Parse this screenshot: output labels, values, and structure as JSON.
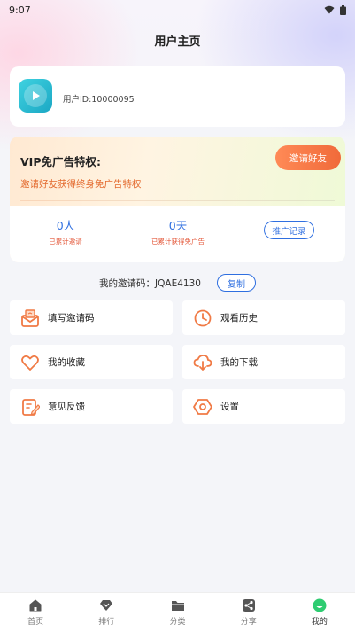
{
  "status_bar": {
    "time": "9:07",
    "icons": [
      "wifi-icon",
      "battery-icon"
    ]
  },
  "header": {
    "title": "用户主页"
  },
  "user": {
    "id_text": "用户ID:10000095",
    "avatar_icon": "play-icon"
  },
  "vip": {
    "title": "VIP免广告特权:",
    "subtitle": "邀请好友获得终身免广告特权",
    "invite_button": "邀请好友",
    "stats": [
      {
        "value": "0人",
        "label": "已累计邀请"
      },
      {
        "value": "0天",
        "label": "已累计获得免广告"
      }
    ],
    "record_button": "推广记录"
  },
  "invite_code": {
    "text": "我的邀请码：JQAE4130",
    "copy_button": "复制"
  },
  "menu": [
    {
      "label": "填写邀请码",
      "icon": "mail-icon"
    },
    {
      "label": "观看历史",
      "icon": "clock-icon"
    },
    {
      "label": "我的收藏",
      "icon": "heart-icon"
    },
    {
      "label": "我的下载",
      "icon": "cloud-download-icon"
    },
    {
      "label": "意见反馈",
      "icon": "edit-icon"
    },
    {
      "label": "设置",
      "icon": "settings-icon"
    }
  ],
  "bottom_nav": [
    {
      "label": "首页",
      "icon": "home-icon"
    },
    {
      "label": "排行",
      "icon": "diamond-icon"
    },
    {
      "label": "分类",
      "icon": "folder-icon"
    },
    {
      "label": "分享",
      "icon": "share-icon"
    },
    {
      "label": "我的",
      "icon": "profile-icon",
      "active": true
    }
  ],
  "colors": {
    "accent_orange": "#f07a45",
    "accent_blue": "#2f6fe0",
    "active_green": "#2ecc71"
  }
}
